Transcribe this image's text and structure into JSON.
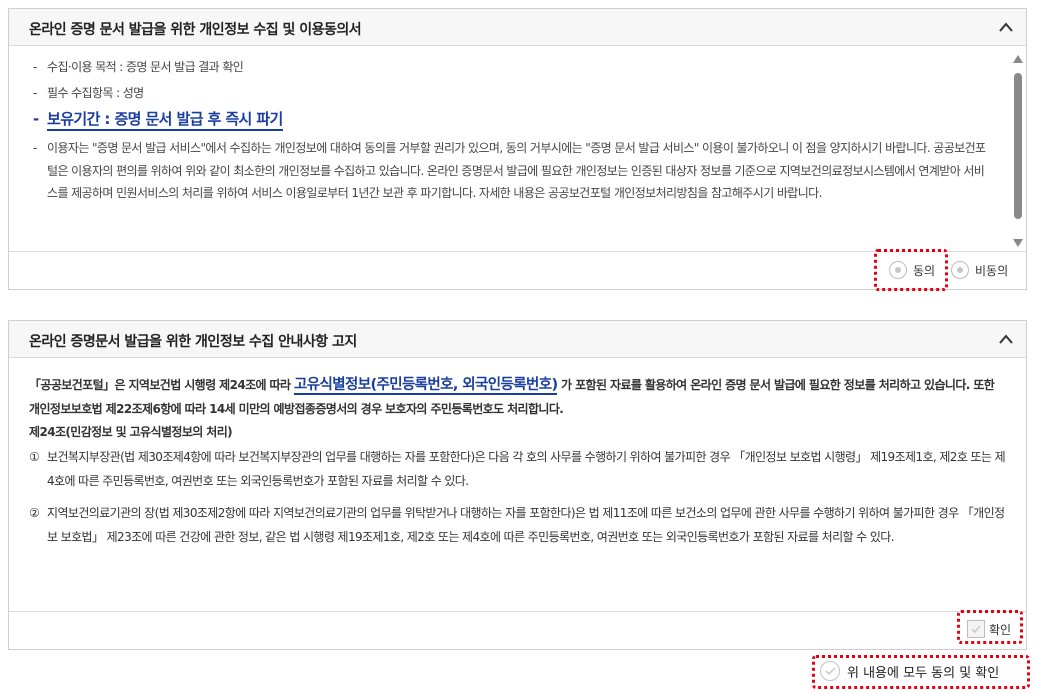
{
  "panel1": {
    "title": "온라인 증명 문서 발급을 위한 개인정보 수집 및 이용동의서",
    "items": [
      "수집·이용 목적 : 증명 문서 발급 결과 확인",
      "필수 수집항목 : 성명",
      "보유기간 : 증명 문서 발급 후 즉시 파기",
      "이용자는 \"증명 문서 발급 서비스\"에서 수집하는 개인정보에 대하여 동의를 거부할 권리가 있으며, 동의 거부시에는 \"증명 문서 발급 서비스\" 이용이 불가하오니 이 점을 양지하시기 바랍니다. 공공보건포털은 이용자의 편의를 위하여 위와 같이 최소한의 개인정보를 수집하고 있습니다. 온라인 증명문서 발급에 필요한 개인정보는 인증된 대상자 정보를 기준으로 지역보건의료정보시스템에서 연계받아 서비스를 제공하며 민원서비스의 처리를 위하여 서비스 이용일로부터 1년간 보관 후 파기합니다. 자세한 내용은 공공보건포털 개인정보처리방침을 참고해주시기 바랍니다."
    ],
    "agree_label": "동의",
    "disagree_label": "비동의"
  },
  "panel2": {
    "title": "온라인 증명문서 발급을 위한 개인정보 수집 안내사항 고지",
    "intro_prefix": "「공공보건포털」은 지역보건법 시행령 제24조에 따라 ",
    "intro_link": "고유식별정보(주민등록번호, 외국인등록번호)",
    "intro_suffix": " 가 포함된 자료를 활용하여 온라인 증명 문서 발급에 필요한 정보를 처리하고 있습니다. 또한 개인정보보호법 제22조제6항에 따라 14세 미만의 예방접종증명서의 경우 보호자의 주민등록번호도 처리합니다.",
    "article_title": "제24조(민감정보 및 고유식별정보의 처리)",
    "items": [
      {
        "num": "①",
        "text": "보건복지부장관(법 제30조제4항에 따라 보건복지부장관의 업무를 대행하는 자를 포함한다)은 다음 각 호의 사무를 수행하기 위하여 불가피한 경우 「개인정보 보호법 시행령」 제19조제1호, 제2호 또는 제4호에 따른 주민등록번호, 여권번호 또는 외국인등록번호가 포함된 자료를 처리할 수 있다."
      },
      {
        "num": "②",
        "text": "지역보건의료기관의 장(법 제30조제2항에 따라 지역보건의료기관의 업무를 위탁받거나 대행하는 자를 포함한다)은 법 제11조에 따른 보건소의 업무에 관한 사무를 수행하기 위하여 불가피한 경우 「개인정보 보호법」 제23조에 따른 건강에 관한 정보, 같은 법 시행령 제19조제1호, 제2호 또는 제4호에 따른 주민등록번호, 여권번호 또는 외국인등록번호가 포함된 자료를 처리할 수 있다."
      }
    ],
    "confirm_label": "확인"
  },
  "all_agree_label": "위 내용에 모두 동의 및 확인",
  "colors": {
    "accent": "#1a3ea0",
    "highlight": "#e60012",
    "border": "#cfcfcf",
    "header_bg": "#f7f7f7"
  }
}
